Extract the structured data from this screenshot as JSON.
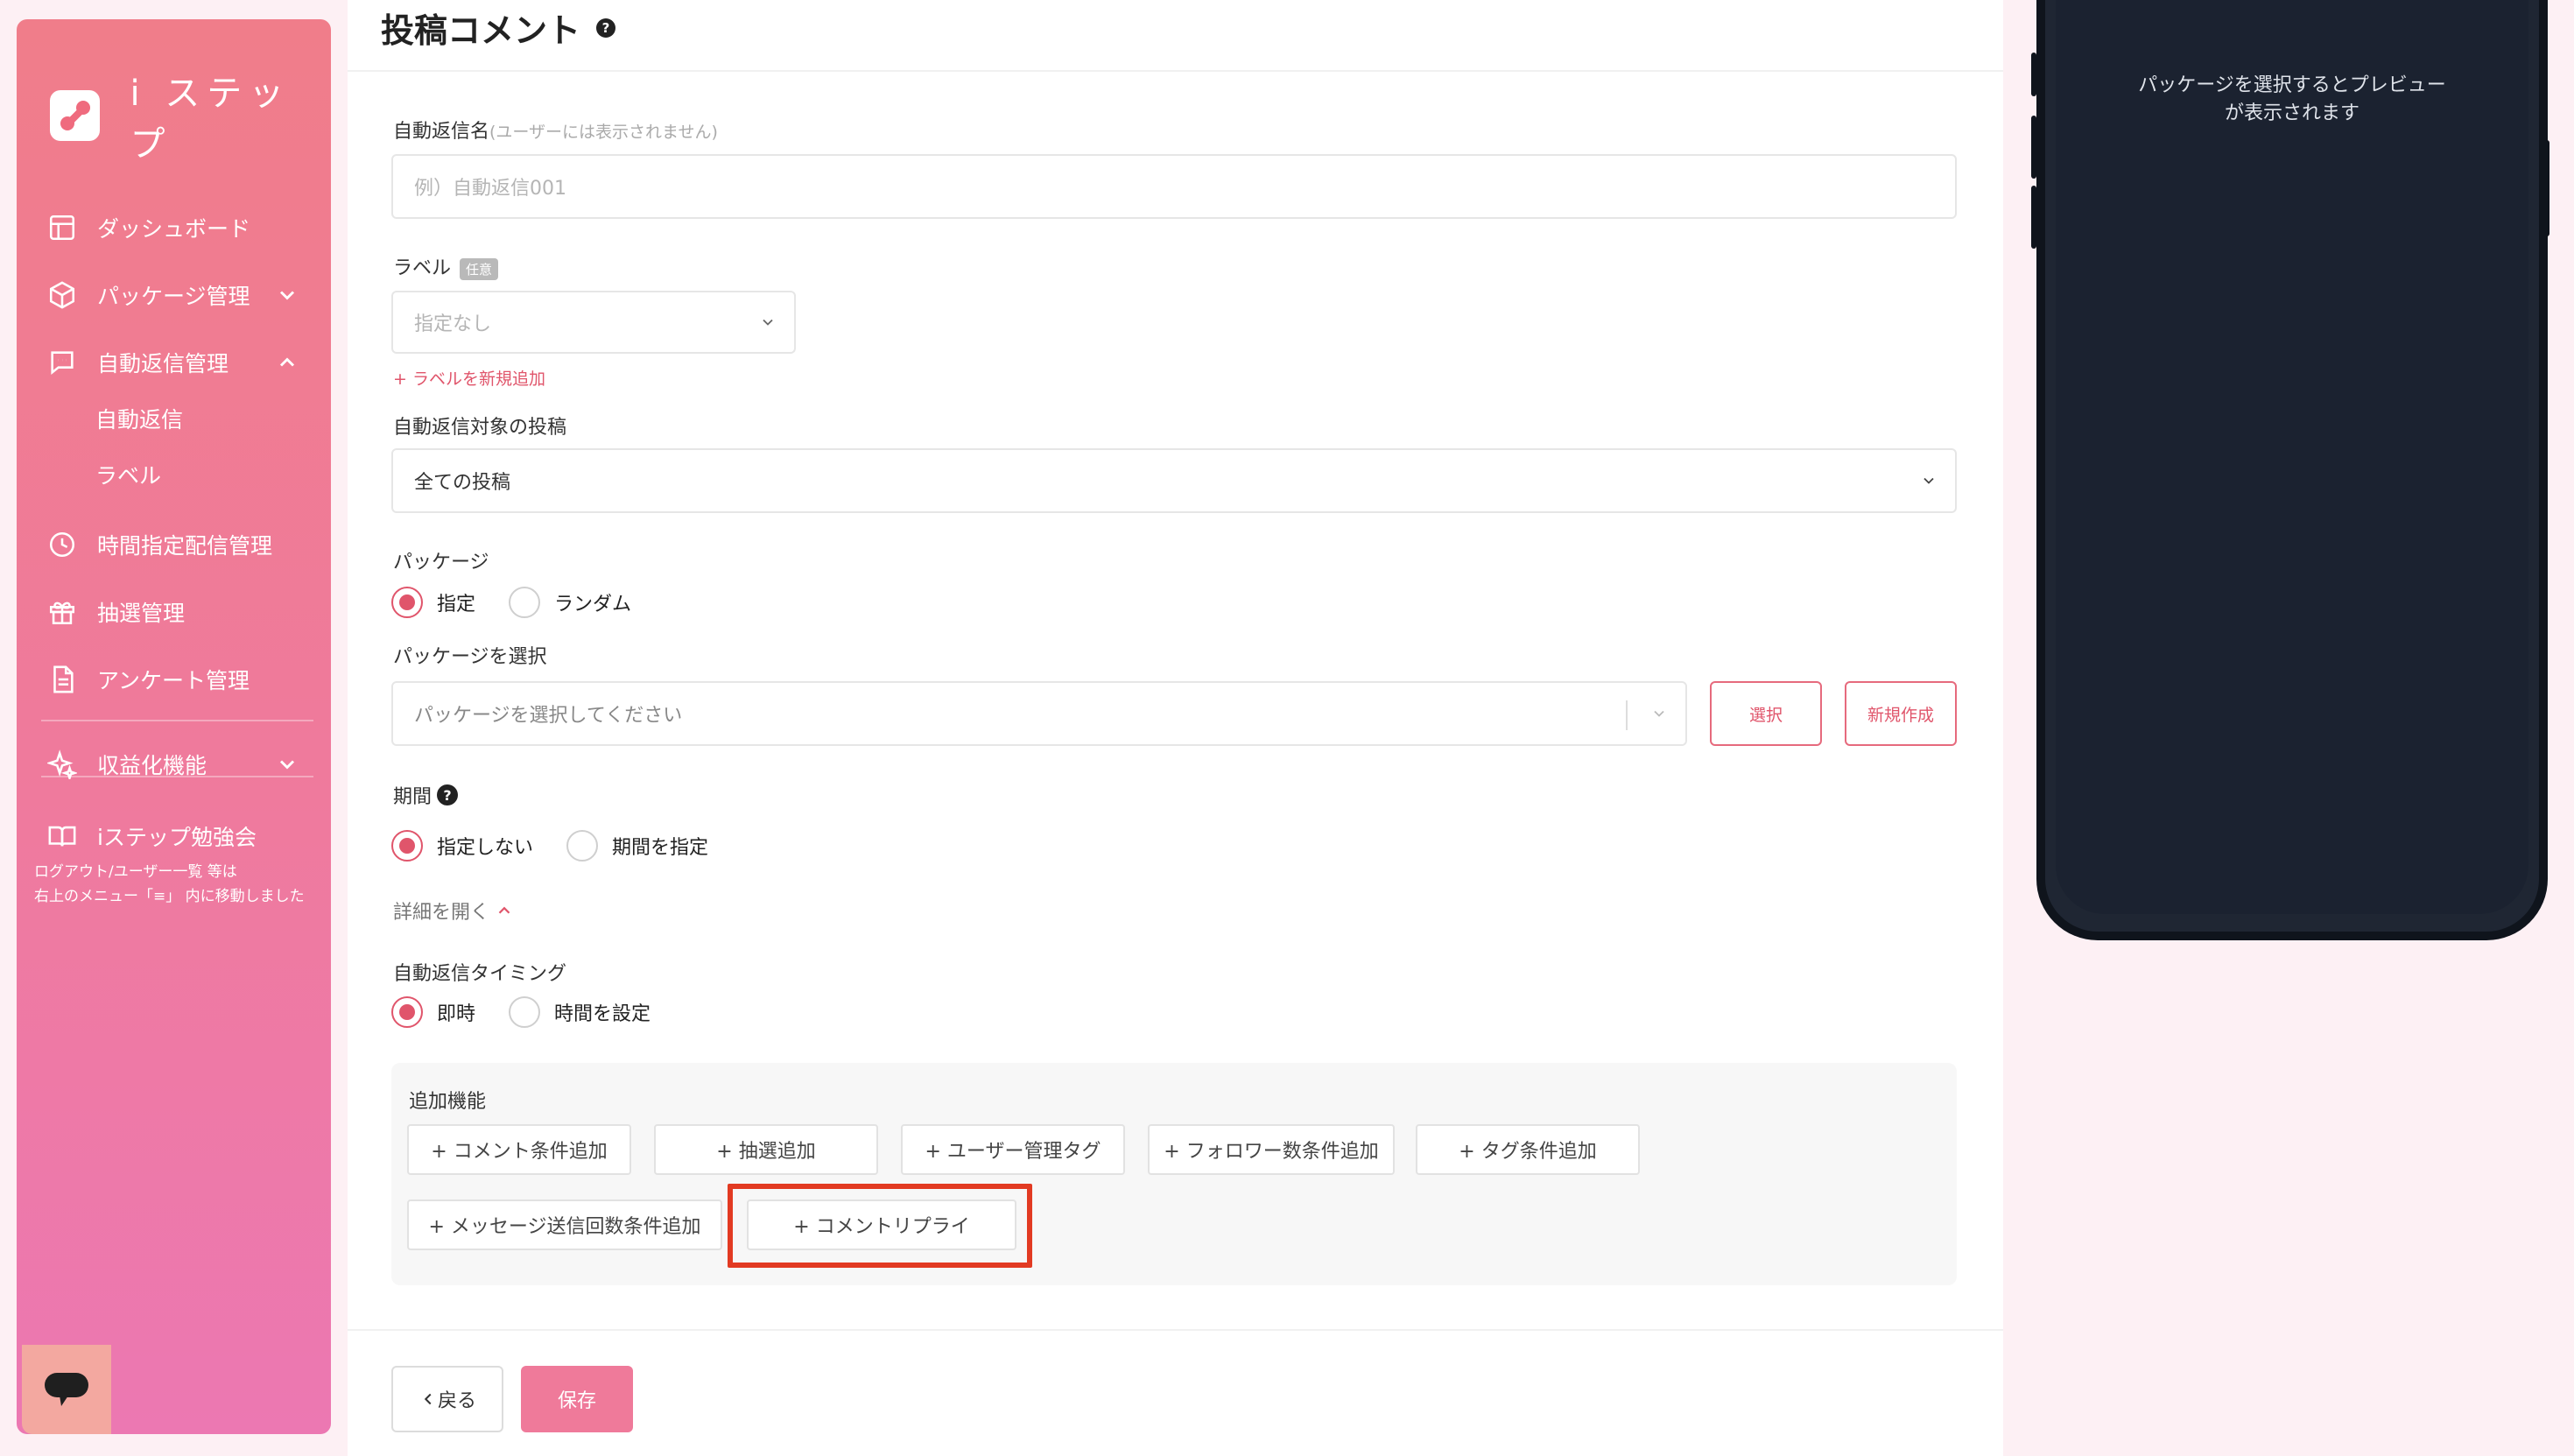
{
  "brand": {
    "name": "i ステップ"
  },
  "sidebar": {
    "items": [
      {
        "label": "ダッシュボード",
        "icon": "dashboard-icon"
      },
      {
        "label": "パッケージ管理",
        "icon": "package-icon"
      },
      {
        "label": "自動返信管理",
        "icon": "chat-icon"
      },
      {
        "label": "時間指定配信管理",
        "icon": "clock-icon"
      },
      {
        "label": "抽選管理",
        "icon": "gift-icon"
      },
      {
        "label": "アンケート管理",
        "icon": "document-icon"
      },
      {
        "label": "収益化機能",
        "icon": "sparkle-icon"
      },
      {
        "label": "iステップ勉強会",
        "icon": "book-icon"
      }
    ],
    "sub_items": [
      "自動返信",
      "ラベル"
    ],
    "note_line1": "ログアウト/ユーザー一覧 等は",
    "note_line2": "右上のメニュー「≡」 内に移動しました"
  },
  "page": {
    "title": "投稿コメント",
    "help": "?"
  },
  "form": {
    "name_label": "自動返信名",
    "name_hint": "(ユーザーには表示されません)",
    "name_placeholder": "例）自動返信001",
    "label_label": "ラベル",
    "label_badge": "任意",
    "label_placeholder": "指定なし",
    "label_add": "+ ラベルを新規追加",
    "target_label": "自動返信対象の投稿",
    "target_value": "全ての投稿",
    "package_label": "パッケージ",
    "package_options": [
      "指定",
      "ランダム"
    ],
    "package_select_label": "パッケージを選択",
    "package_select_placeholder": "パッケージを選択してください",
    "select_button": "選択",
    "new_button": "新規作成",
    "period_label": "期間",
    "period_options": [
      "指定しない",
      "期間を指定"
    ],
    "details_toggle": "詳細を開く",
    "timing_label": "自動返信タイミング",
    "timing_options": [
      "即時",
      "時間を設定"
    ],
    "extras_label": "追加機能",
    "extras": [
      "+ コメント条件追加",
      "+ 抽選追加",
      "+ ユーザー管理タグ",
      "+ フォロワー数条件追加",
      "+ タグ条件追加",
      "+ メッセージ送信回数条件追加",
      "+ コメントリプライ"
    ]
  },
  "footer": {
    "back": "戻る",
    "save": "保存"
  },
  "preview": {
    "line1": "パッケージを選択するとプレビュー",
    "line2": "が表示されます"
  },
  "colors": {
    "accent": "#e0556b",
    "highlight": "#e23a22",
    "sidebar_top": "#f07d8a",
    "sidebar_bottom": "#ec78b2"
  }
}
